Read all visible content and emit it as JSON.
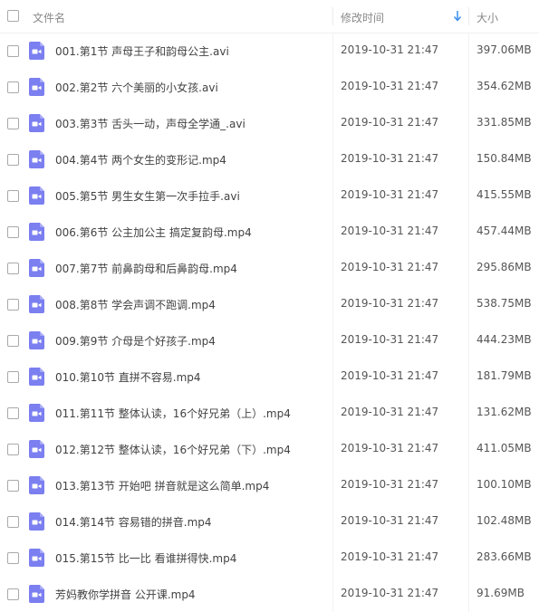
{
  "header": {
    "name_label": "文件名",
    "date_label": "修改时间",
    "size_label": "大小",
    "sort_icon": "arrow-down-icon"
  },
  "colors": {
    "icon_purple": "#7b7ff0",
    "sort_arrow": "#3b8ff0"
  },
  "files": [
    {
      "name": "001.第1节 声母王子和韵母公主.avi",
      "date": "2019-10-31 21:47",
      "size": "397.06MB"
    },
    {
      "name": "002.第2节 六个美丽的小女孩.avi",
      "date": "2019-10-31 21:47",
      "size": "354.62MB"
    },
    {
      "name": "003.第3节 舌头一动，声母全学通_.avi",
      "date": "2019-10-31 21:47",
      "size": "331.85MB"
    },
    {
      "name": "004.第4节 两个女生的变形记.mp4",
      "date": "2019-10-31 21:47",
      "size": "150.84MB"
    },
    {
      "name": "005.第5节 男生女生第一次手拉手.avi",
      "date": "2019-10-31 21:47",
      "size": "415.55MB"
    },
    {
      "name": "006.第6节 公主加公主 搞定复韵母.mp4",
      "date": "2019-10-31 21:47",
      "size": "457.44MB"
    },
    {
      "name": "007.第7节 前鼻韵母和后鼻韵母.mp4",
      "date": "2019-10-31 21:47",
      "size": "295.86MB"
    },
    {
      "name": "008.第8节 学会声调不跑调.mp4",
      "date": "2019-10-31 21:47",
      "size": "538.75MB"
    },
    {
      "name": "009.第9节 介母是个好孩子.mp4",
      "date": "2019-10-31 21:47",
      "size": "444.23MB"
    },
    {
      "name": "010.第10节 直拼不容易.mp4",
      "date": "2019-10-31 21:47",
      "size": "181.79MB"
    },
    {
      "name": "011.第11节 整体认读，16个好兄弟（上）.mp4",
      "date": "2019-10-31 21:47",
      "size": "131.62MB"
    },
    {
      "name": "012.第12节 整体认读，16个好兄弟（下）.mp4",
      "date": "2019-10-31 21:47",
      "size": "411.05MB"
    },
    {
      "name": "013.第13节 开始吧 拼音就是这么简单.mp4",
      "date": "2019-10-31 21:47",
      "size": "100.10MB"
    },
    {
      "name": "014.第14节 容易错的拼音.mp4",
      "date": "2019-10-31 21:47",
      "size": "102.48MB"
    },
    {
      "name": "015.第15节 比一比 看谁拼得快.mp4",
      "date": "2019-10-31 21:47",
      "size": "283.66MB"
    },
    {
      "name": "芳妈教你学拼音  公开课.mp4",
      "date": "2019-10-31 21:47",
      "size": "91.69MB"
    }
  ]
}
